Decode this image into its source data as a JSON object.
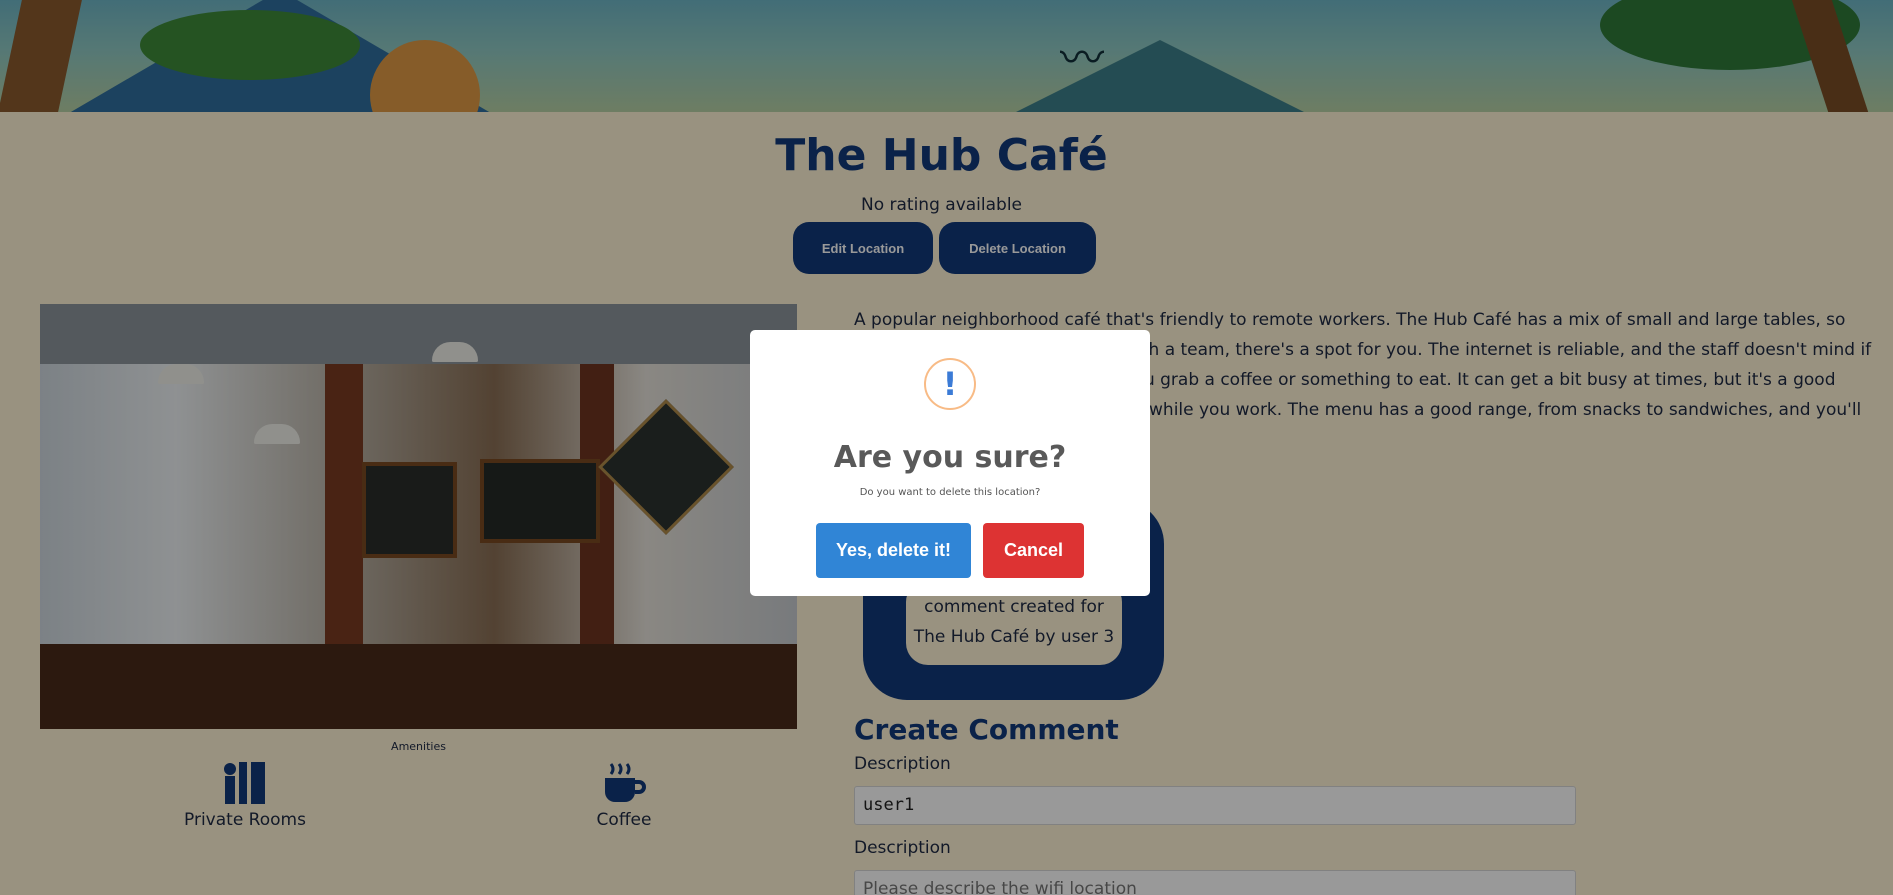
{
  "location": {
    "name": "The Hub Café",
    "rating_text": "No rating available",
    "edit_label": "Edit Location",
    "delete_label": "Delete Location",
    "description": "A popular neighborhood café that's friendly to remote workers. The Hub Café has a mix of small and large tables, so whether you're working solo or with a team, there's a spot for you. The internet is reliable, and the staff doesn't mind if you stay for a while, as long as you grab a coffee or something to eat. It can get a bit busy at times, but it's a good place if you like background noise while you work. The menu has a good range, from snacks to sandwiches, and you'll often meet like-minded people."
  },
  "amenities": {
    "title": "Amenities",
    "items": [
      {
        "label": "Private Rooms",
        "icon": "private-rooms-icon"
      },
      {
        "label": "Coffee",
        "icon": "coffee-icon"
      }
    ]
  },
  "comments": [
    {
      "text": "comment created for The Hub Café by user 3"
    }
  ],
  "create_comment": {
    "title": "Create Comment",
    "field1_label": "Description",
    "field1_value": "user1",
    "field2_label": "Description",
    "field2_placeholder": "Please describe the wifi location"
  },
  "dialog": {
    "icon": "!",
    "title": "Are you sure?",
    "text": "Do you want to delete this location?",
    "confirm_label": "Yes, delete it!",
    "cancel_label": "Cancel"
  },
  "colors": {
    "navy": "#123a7a",
    "cream": "#fff3d6",
    "confirm": "#3085d6",
    "cancel": "#dd3333"
  }
}
